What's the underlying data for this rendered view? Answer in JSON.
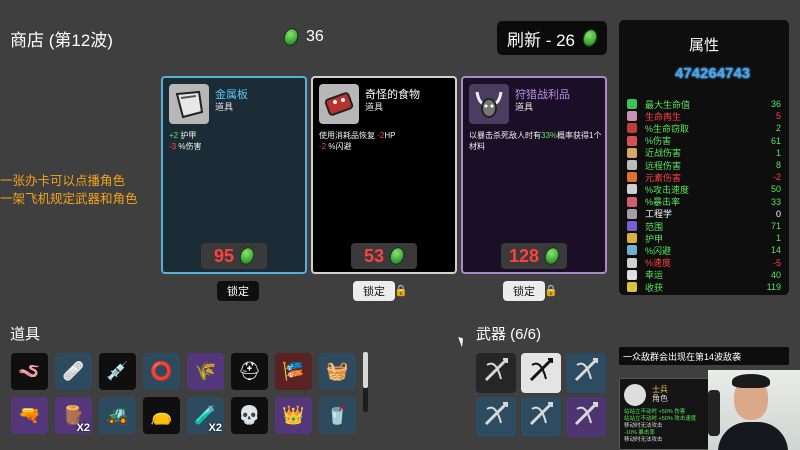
{
  "header": {
    "shop_title": "商店 (第12波)",
    "materials": "36",
    "reroll_label": "刷新 - 26"
  },
  "overlay": {
    "line1": "一张办卡可以点播角色",
    "line2": "一架飞机规定武器和角色"
  },
  "cards": [
    {
      "name": "金属板",
      "type": "道具",
      "effects": [
        {
          "sign": "+2",
          "sign_class": "pos",
          "text": " 护甲"
        },
        {
          "sign": "-3",
          "sign_class": "neg",
          "text": " %伤害"
        }
      ],
      "price": "95",
      "lock_label": "锁定"
    },
    {
      "name": "奇怪的食物",
      "type": "道具",
      "effect_line1_pre": "使用消耗品恢复 ",
      "effect_line1_val": "-2",
      "effect_line1_post": "HP",
      "effect_line2_val": "-2",
      "effect_line2_post": " %闪避",
      "price": "53",
      "lock_label": "锁定"
    },
    {
      "name": "狩猎战利品",
      "type": "道具",
      "effect_pre": "以暴击杀死敌人时有",
      "effect_hl": "33%",
      "effect_post": "概率获得1个材料",
      "price": "128",
      "lock_label": "锁定"
    }
  ],
  "stats": {
    "title": "属性",
    "player_id": "474264743",
    "rows": [
      {
        "label": "最大生命值",
        "value": "36",
        "tone": "green",
        "icon_color": "#3fbf5a"
      },
      {
        "label": "生命再生",
        "value": "5",
        "tone": "red",
        "icon_color": "#c98fb0"
      },
      {
        "label": "%生命窃取",
        "value": "2",
        "tone": "green",
        "icon_color": "#c23b3b"
      },
      {
        "label": "%伤害",
        "value": "61",
        "tone": "green",
        "icon_color": "#d85050"
      },
      {
        "label": "近战伤害",
        "value": "1",
        "tone": "green",
        "icon_color": "#d5a76a"
      },
      {
        "label": "远程伤害",
        "value": "8",
        "tone": "green",
        "icon_color": "#bbbbbb"
      },
      {
        "label": "元素伤害",
        "value": "-2",
        "tone": "red",
        "icon_color": "#e07030"
      },
      {
        "label": "%攻击速度",
        "value": "50",
        "tone": "green",
        "icon_color": "#d0d0d0"
      },
      {
        "label": "%暴击率",
        "value": "33",
        "tone": "green",
        "icon_color": "#d06070"
      },
      {
        "label": "工程学",
        "value": "0",
        "tone": "white",
        "icon_color": "#a0a0a0"
      },
      {
        "label": "范围",
        "value": "71",
        "tone": "green",
        "icon_color": "#7a5fd0"
      },
      {
        "label": "护甲",
        "value": "1",
        "tone": "green",
        "icon_color": "#d8b040"
      },
      {
        "label": "%闪避",
        "value": "14",
        "tone": "green",
        "icon_color": "#6fb0d0"
      },
      {
        "label": "%速度",
        "value": "-5",
        "tone": "red",
        "icon_color": "#d0d0d0"
      },
      {
        "label": "幸运",
        "value": "40",
        "tone": "green",
        "icon_color": "#e0e0e0"
      },
      {
        "label": "收获",
        "value": "119",
        "tone": "green",
        "icon_color": "#d8c040"
      }
    ]
  },
  "inventory": {
    "title": "道具",
    "items": [
      {
        "icon": "worm-icon",
        "glyph": "🪱",
        "tier": "black",
        "badge": ""
      },
      {
        "icon": "bandage-icon",
        "glyph": "🩹",
        "tier": "blue",
        "badge": ""
      },
      {
        "icon": "syringe-icon",
        "glyph": "💉",
        "tier": "black",
        "badge": ""
      },
      {
        "icon": "target-ring-icon",
        "glyph": "⭕",
        "tier": "blue",
        "badge": ""
      },
      {
        "icon": "wheat-icon",
        "glyph": "🌾",
        "tier": "purple",
        "badge": ""
      },
      {
        "icon": "helmet-icon",
        "glyph": "⛑",
        "tier": "black",
        "badge": ""
      },
      {
        "icon": "banner-icon",
        "glyph": "🎏",
        "tier": "red",
        "badge": ""
      },
      {
        "icon": "grill-icon",
        "glyph": "🧺",
        "tier": "blue",
        "badge": ""
      },
      {
        "icon": "cannon-icon",
        "glyph": "🔫",
        "tier": "purple",
        "badge": ""
      },
      {
        "icon": "tree-stump-icon",
        "glyph": "🪵",
        "tier": "purple",
        "badge": "X2"
      },
      {
        "icon": "tractor-icon",
        "glyph": "🚜",
        "tier": "blue",
        "badge": ""
      },
      {
        "icon": "bag-icon",
        "glyph": "👝",
        "tier": "black",
        "badge": ""
      },
      {
        "icon": "potion-icon",
        "glyph": "🧪",
        "tier": "blue",
        "badge": "X2"
      },
      {
        "icon": "skull-mask-icon",
        "glyph": "💀",
        "tier": "black",
        "badge": ""
      },
      {
        "icon": "crown-icon",
        "glyph": "👑",
        "tier": "purple",
        "badge": ""
      },
      {
        "icon": "cup-icon",
        "glyph": "🥤",
        "tier": "blue",
        "badge": ""
      }
    ]
  },
  "weapons": {
    "title": "武器 (6/6)",
    "items": [
      {
        "icon": "crossbow-icon",
        "tier": "dark"
      },
      {
        "icon": "crossbow-icon",
        "tier": "light"
      },
      {
        "icon": "crossbow-icon",
        "tier": "blue"
      },
      {
        "icon": "crossbow-icon",
        "tier": "blue"
      },
      {
        "icon": "crossbow-icon",
        "tier": "blue"
      },
      {
        "icon": "crossbow-icon",
        "tier": "purple"
      }
    ]
  },
  "wave_notice": "一众敌群会出现在第14波敌袭",
  "character": {
    "name": "士兵",
    "type": "角色",
    "lines": [
      "站站立不动时 +50% 伤害",
      "站站立不动时 +50% 攻击速度",
      "移动时无法攻击",
      "-10% 暴击率",
      "移动时无法攻击"
    ]
  },
  "colors": {
    "material_green": "#4fbf43",
    "price_red": "#ff4040",
    "uncommon_blue": "#57b0d8",
    "rare_purple": "#a98bc5",
    "overlay_orange": "#f4a21c"
  }
}
